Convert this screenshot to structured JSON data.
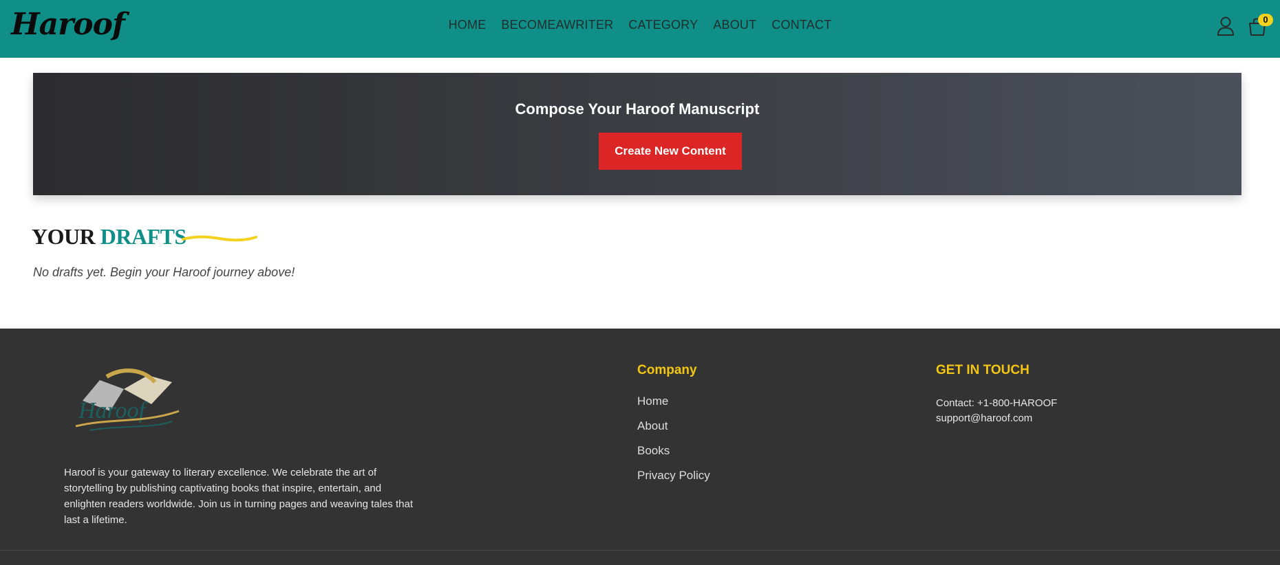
{
  "brand": {
    "logo_text": "Haroof"
  },
  "nav": {
    "items": [
      "HOME",
      "BECOMEAWRITER",
      "CATEGORY",
      "ABOUT",
      "CONTACT"
    ]
  },
  "header_icons": {
    "user_icon": "user-icon",
    "cart_icon": "shopping-bag-icon",
    "cart_count": "0"
  },
  "banner": {
    "title": "Compose Your Haroof Manuscript",
    "button_label": "Create New Content"
  },
  "drafts": {
    "heading_word1": "YOUR",
    "heading_word2": "DRAFTS",
    "empty_message": "No drafts yet. Begin your Haroof journey above!"
  },
  "footer": {
    "description": "Haroof is your gateway to literary excellence. We celebrate the art of storytelling by publishing captivating books that inspire, entertain, and enlighten readers worldwide. Join us in turning pages and weaving tales that last a lifetime.",
    "company_title": "Company",
    "company_links": [
      "Home",
      "About",
      "Books",
      "Privacy Policy"
    ],
    "contact_title": "GET IN TOUCH",
    "contact_phone": "Contact: +1-800-HAROOF",
    "contact_email": "support@haroof.com"
  },
  "colors": {
    "header_bg": "#0f8f87",
    "accent_yellow": "#f3c614",
    "button_red": "#dc2626",
    "footer_bg": "#333333"
  }
}
